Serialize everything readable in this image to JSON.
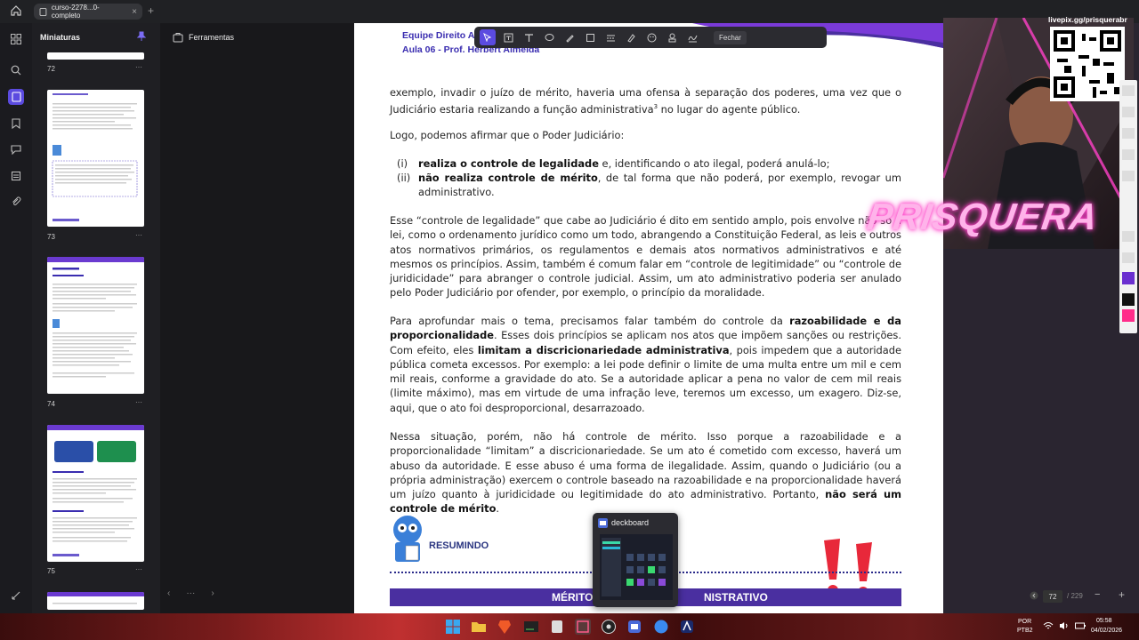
{
  "browser": {
    "tab_title": "curso-2278...0-completo",
    "tab_close": "×",
    "new_tab": "+"
  },
  "thumbnails": {
    "title": "Miniaturas",
    "pages": [
      {
        "number": "72",
        "more": "···"
      },
      {
        "number": "73",
        "more": "···"
      },
      {
        "number": "74",
        "more": "···"
      },
      {
        "number": "75",
        "more": "···"
      }
    ],
    "nav_prev": "‹",
    "nav_more": "···",
    "nav_next": "›"
  },
  "tools_panel": {
    "title": "Ferramentas"
  },
  "toolbar": {
    "close_label": "Fechar",
    "icons": [
      "select-icon",
      "text-box-icon",
      "text-icon",
      "comment-icon",
      "pen-icon",
      "shape-icon",
      "line-icon",
      "highlight-icon",
      "sticker-icon",
      "stamp-icon",
      "signature-icon"
    ]
  },
  "document": {
    "header_line1": "Equipe Direito Ac",
    "header_line2": "Aula 06 - Prof. Herbert Almeida",
    "p1_a": "exemplo, invadir o juízo de mérito, haveria uma ofensa à separação dos poderes, uma vez que o Judiciário estaria realizando a função administrativa",
    "p1_sup": "3",
    "p1_b": " no lugar do agente público.",
    "p2": "Logo, podemos afirmar que o Poder Judiciário:",
    "item1_num": "(i)",
    "item1_bold": "realiza o controle de legalidade",
    "item1_rest": " e, identificando o ato ilegal, poderá anulá-lo;",
    "item2_num": "(ii)",
    "item2_bold": "não realiza controle de mérito",
    "item2_rest": ", de tal forma que não poderá, por exemplo, revogar um administrativo.",
    "p3": "Esse “controle de legalidade” que cabe ao Judiciário é dito em sentido amplo, pois envolve não só a lei, como o ordenamento jurídico como um todo, abrangendo a Constituição Federal, as leis e outros atos normativos primários, os regulamentos e demais atos normativos administrativos e até mesmos os princípios. Assim, também é comum falar em “controle de legitimidade” ou “controle de juridicidade” para abranger o controle judicial. Assim, um ato administrativo poderia ser anulado pelo Poder Judiciário por ofender, por exemplo, o princípio da moralidade.",
    "p4_a": "Para aprofundar mais o tema, precisamos falar também do controle da ",
    "p4_bold1": "razoabilidade e da proporcionalidade",
    "p4_b": ". Esses dois princípios se aplicam nos atos que impõem sanções ou restrições. Com efeito, eles ",
    "p4_bold2": "limitam a discricionariedade administrativa",
    "p4_c": ", pois impedem que a autoridade pública cometa excessos. Por exemplo: a lei pode definir o limite de uma multa entre um mil e cem mil reais, conforme a gravidade do ato. Se a autoridade aplicar a pena no valor de cem mil reais (limite máximo), mas em virtude de uma infração leve, teremos um excesso, um exagero. Diz-se, aqui, que o ato foi desproporcional, desarrazoado.",
    "p5_a": "Nessa situação, porém, não há controle de mérito. Isso porque a razoabilidade e a proporcionalidade “limitam” a discricionariedade. Se um ato é cometido com excesso, haverá um abuso da autoridade. E esse abuso é uma forma de ilegalidade. Assim, quando o Judiciário (ou a própria administração) exercem o controle baseado na razoabilidade e na proporcionalidade haverá um juízo quanto à juridicidade ou legitimidade do ato administrativo. Portanto, ",
    "p5_bold": "não será um controle de mérito",
    "p5_b": ".",
    "resumindo_label": "RESUMINDO",
    "banner_left": "MÉRITO",
    "banner_right": "NISTRATIVO"
  },
  "deckboard": {
    "title": "deckboard"
  },
  "stream": {
    "livepix": "livepix.gg/prisquerabr",
    "brand": "PRISQUERA"
  },
  "viewer": {
    "current_page": "72",
    "total_pages": "/ 229",
    "zoom_out": "−",
    "zoom_in": "+"
  },
  "taskbar": {
    "lang1": "POR",
    "lang2": "PTB2",
    "time": "05:58",
    "date": "04/02/2026"
  },
  "colors": {
    "accent": "#5b4be0",
    "doc_header": "#3a2db0",
    "banner": "#4a2fa0",
    "brand_glow": "#ff40c8"
  }
}
